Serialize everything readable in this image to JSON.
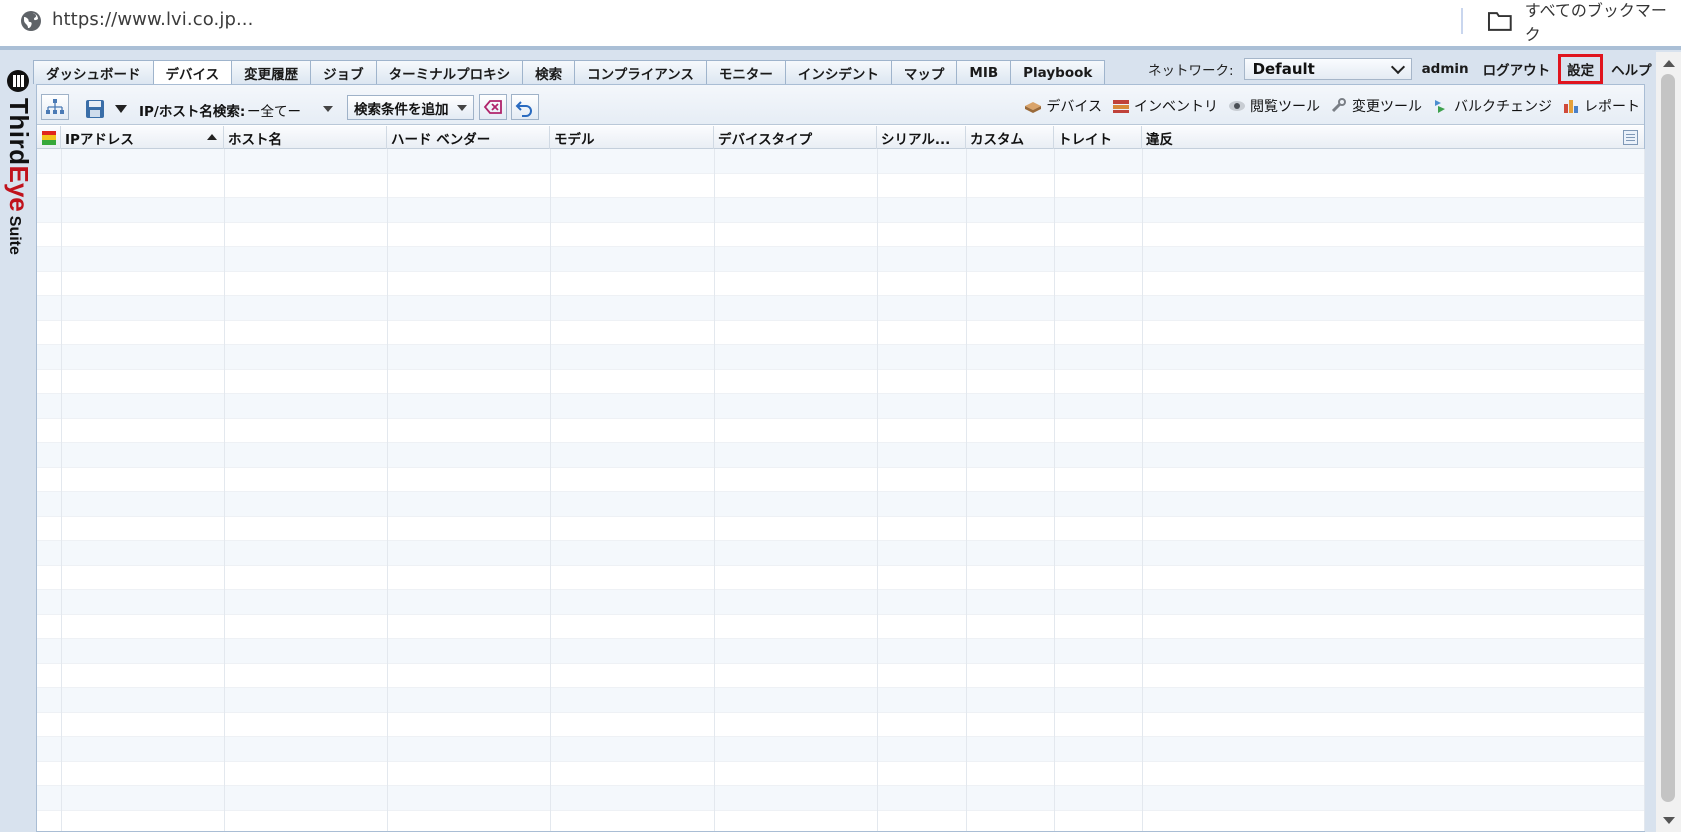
{
  "browser": {
    "url": "https://www.lvi.co.jp...",
    "bookmarks_label": "すべてのブックマーク"
  },
  "brand": {
    "third": "Third",
    "eye": "Eye",
    "suite": "Suite"
  },
  "tabs": [
    {
      "label": "ダッシュボード"
    },
    {
      "label": "デバイス"
    },
    {
      "label": "変更履歴"
    },
    {
      "label": "ジョブ"
    },
    {
      "label": "ターミナルプロキシ"
    },
    {
      "label": "検索"
    },
    {
      "label": "コンプライアンス"
    },
    {
      "label": "モニター"
    },
    {
      "label": "インシデント"
    },
    {
      "label": "マップ"
    },
    {
      "label": "MIB"
    },
    {
      "label": "Playbook"
    }
  ],
  "active_tab": "デバイス",
  "topbar": {
    "network_label": "ネットワーク:",
    "network_value": "Default",
    "user": "admin",
    "logout": "ログアウト",
    "settings": "設定",
    "help": "ヘルプ"
  },
  "toolbar": {
    "search_label": "IP/ホスト名検索:",
    "search_value": "ー全てー",
    "add_condition": "検索条件を追加",
    "right_tools": [
      {
        "label": "デバイス"
      },
      {
        "label": "インベントリ"
      },
      {
        "label": "閲覧ツール"
      },
      {
        "label": "変更ツール"
      },
      {
        "label": "バルクチェンジ"
      },
      {
        "label": "レポート"
      }
    ]
  },
  "grid": {
    "columns": [
      {
        "label": "IPアドレス"
      },
      {
        "label": "ホスト名"
      },
      {
        "label": "ハード ベンダー"
      },
      {
        "label": "モデル"
      },
      {
        "label": "デバイスタイプ"
      },
      {
        "label": "シリアル..."
      },
      {
        "label": "カスタム"
      },
      {
        "label": "トレイト"
      },
      {
        "label": "違反"
      }
    ],
    "rows": []
  },
  "colors": {
    "accent_red": "#e0141e",
    "brand_red": "#c0121c",
    "frame_blue": "#d8e2ee"
  }
}
